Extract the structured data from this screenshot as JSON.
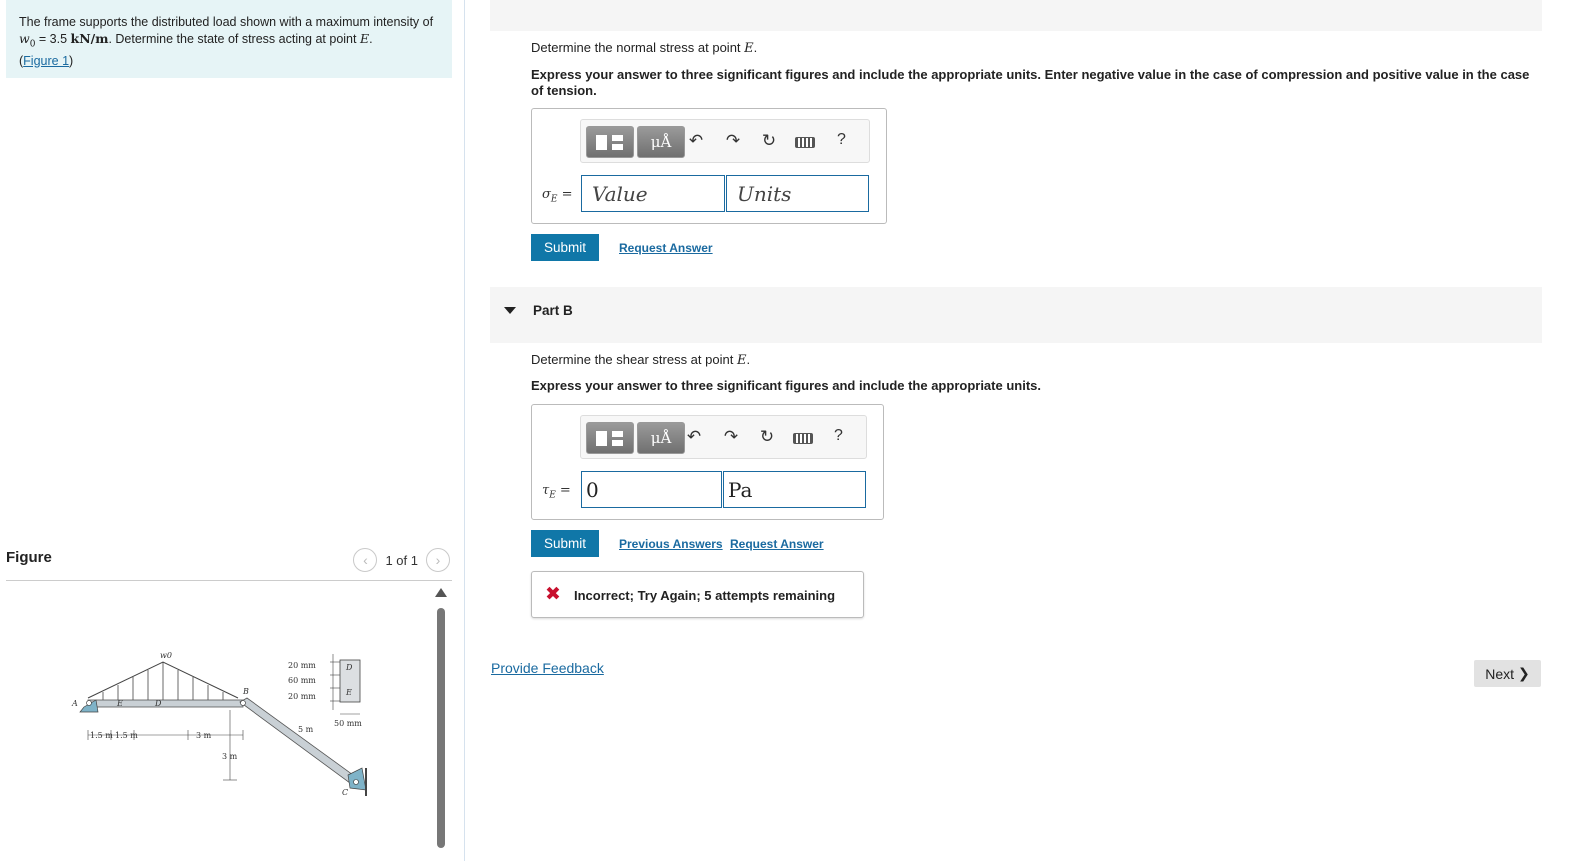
{
  "problem": {
    "text_before": "The frame supports the distributed load shown with a maximum intensity of ",
    "w_symbol": "w",
    "w_sub": "0",
    "eq": " = 3.5 ",
    "unit": "kN/m",
    "text_after": ". Determine the state of stress acting at point ",
    "point": "E",
    "period": ".",
    "figure_link": "Figure 1"
  },
  "figure_panel": {
    "title": "Figure",
    "pager_text": "1 of 1",
    "prev_icon": "chevron-left-icon",
    "next_icon": "chevron-right-icon",
    "labels": {
      "w0": "w0",
      "mm20a": "20 mm",
      "mm60": "60 mm",
      "mm20b": "20 mm",
      "D_sec": "D",
      "E_sec": "E",
      "mm50": "50 mm",
      "A": "A",
      "E": "E",
      "D": "D",
      "B": "B",
      "C": "C",
      "m5": "5 m",
      "m15a": "1.5 m",
      "m15b": "1.5 m",
      "m3a": "3 m",
      "m3b": "3 m"
    }
  },
  "partA": {
    "question_prefix": "Determine the normal stress at point ",
    "question_point": "E",
    "question_suffix": ".",
    "instruction": "Express your answer to three significant figures and include the appropriate units. Enter negative value in the case of compression and positive value in the case of tension.",
    "var_symbol": "σ",
    "var_sub": "E",
    "var_eq": " =",
    "value_placeholder": "Value",
    "units_placeholder": "Units",
    "submit_label": "Submit",
    "request_label": "Request Answer"
  },
  "partB": {
    "label": "Part B",
    "question_prefix": "Determine the shear stress at point ",
    "question_point": "E",
    "question_suffix": ".",
    "instruction": "Express your answer to three significant figures and include the appropriate units.",
    "var_symbol": "τ",
    "var_sub": "E",
    "var_eq": " =",
    "value": "0",
    "units": "Pa",
    "submit_label": "Submit",
    "previous_label": "Previous Answers",
    "request_label": "Request Answer",
    "feedback": "Incorrect; Try Again; 5 attempts remaining"
  },
  "toolbar": {
    "mu_label": "μÅ",
    "help_label": "?"
  },
  "footer": {
    "provide_feedback": "Provide Feedback",
    "next_label": "Next",
    "next_icon": "chevron-right-icon"
  },
  "colors": {
    "problem_bg": "#e6f4f6",
    "link": "#1a6aa0",
    "submit_bg": "#1077a8",
    "error_red": "#c8102e"
  }
}
